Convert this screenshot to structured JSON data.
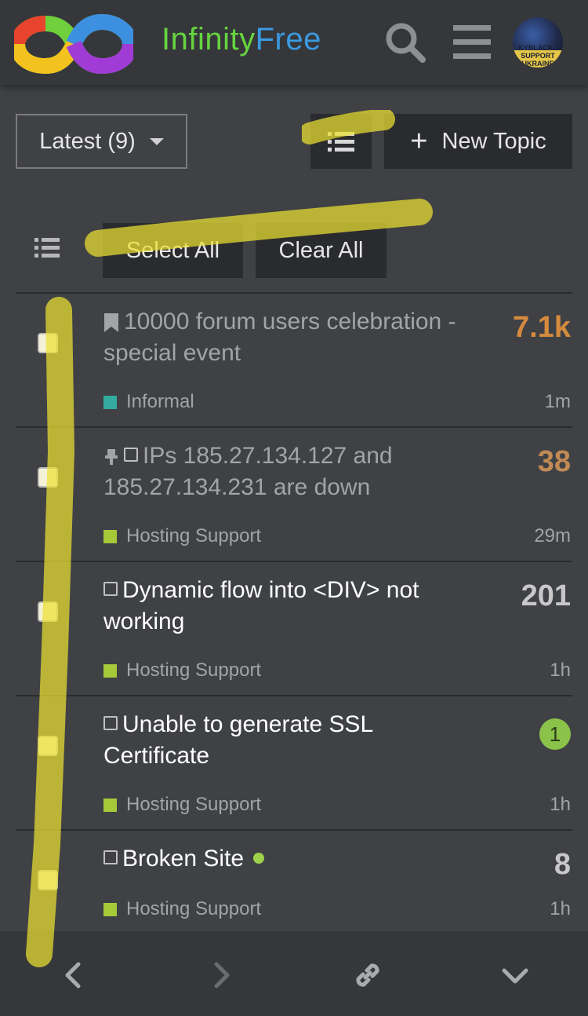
{
  "header": {
    "brand_part1": "Infinity",
    "brand_part2": "Free",
    "avatar_text": "KYBLACK · SUPPORT UKRAINE"
  },
  "toolbar": {
    "filter_label": "Latest (9)",
    "new_topic_label": "New Topic"
  },
  "bulk": {
    "select_all_label": "Select All",
    "clear_all_label": "Clear All"
  },
  "topics": [
    {
      "title": "10000 forum users celebration - special event",
      "category": "Informal",
      "category_color": "#33aaa0",
      "count": "7.1k",
      "count_color": "#d68a3d",
      "age": "1m",
      "status_icon": "bookmark-icon",
      "visited": true
    },
    {
      "title": "IPs 185.27.134.127 and 185.27.134.231 are down",
      "category": "Hosting Support",
      "category_color": "#a6c93a",
      "count": "38",
      "count_color": "#c18a55",
      "age": "29m",
      "status_icon": "pin-icon",
      "visited": true
    },
    {
      "title": "Dynamic flow into <DIV> not working",
      "category": "Hosting Support",
      "category_color": "#a6c93a",
      "count": "201",
      "count_color": "#c8c8c8",
      "age": "1h",
      "status_icon": "unsolved-icon",
      "visited": false
    },
    {
      "title": "Unable to generate SSL Certificate",
      "category": "Hosting Support",
      "category_color": "#a6c93a",
      "count": "1",
      "age": "1h",
      "status_icon": "unsolved-icon",
      "visited": false
    },
    {
      "title": "Broken Site",
      "category": "Hosting Support",
      "category_color": "#a6c93a",
      "count": "8",
      "count_color": "#c8c8c8",
      "age": "1h",
      "status_icon": "unsolved-icon",
      "visited": false
    }
  ]
}
